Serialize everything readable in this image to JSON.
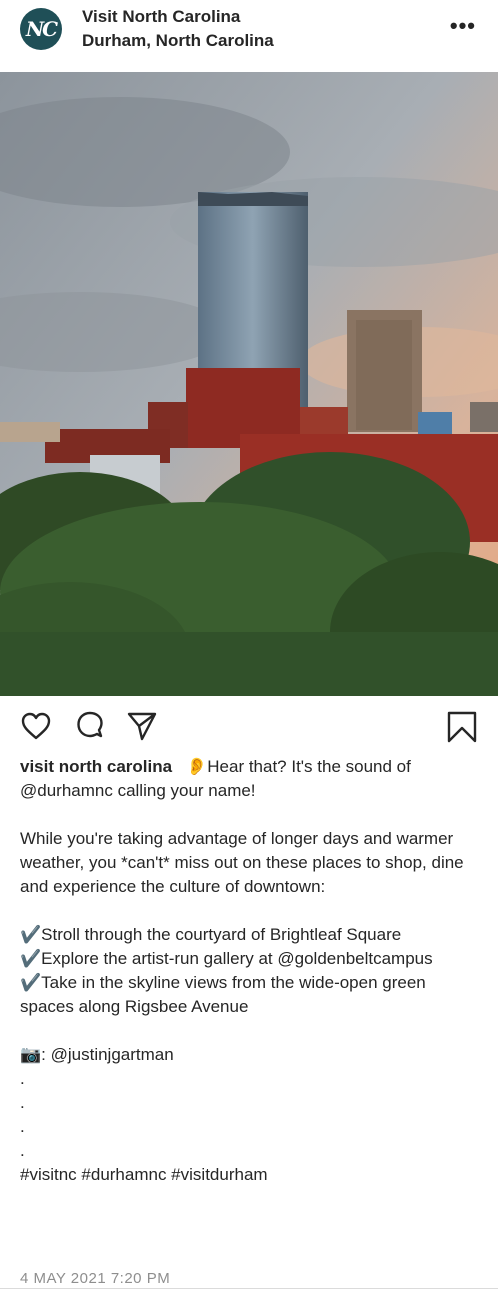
{
  "header": {
    "avatar_text": "NC",
    "account_name": "Visit North Carolina",
    "location": "Durham, North Carolina",
    "more_label": "•••"
  },
  "actions": {
    "like": "heart-icon",
    "comment": "comment-icon",
    "share": "send-icon",
    "save": "bookmark-icon"
  },
  "caption": {
    "username": "visit north carolina",
    "intro": "👂Hear that? It's the sound of @durhamnc calling your name!",
    "paragraph": "While you're taking advantage of longer days and warmer weather, you *can't* miss out on these places to shop, dine and experience the culture of downtown:",
    "items": [
      "✔️Stroll through the courtyard of Brightleaf Square",
      "✔️Explore the artist-run gallery at @goldenbeltcampus",
      "✔️Take in the skyline views from the wide-open green spaces along Rigsbee Avenue"
    ],
    "credit": "📷: @justinjgartman",
    "dots": [
      ".",
      ".",
      ".",
      "."
    ],
    "hashtags": "#visitnc #durhamnc #visitdurham"
  },
  "timestamp": "4 MAY 2021 7:20 PM",
  "colors": {
    "avatar_bg": "#1f4f57",
    "text": "#262626",
    "muted": "#8e8e8e"
  }
}
